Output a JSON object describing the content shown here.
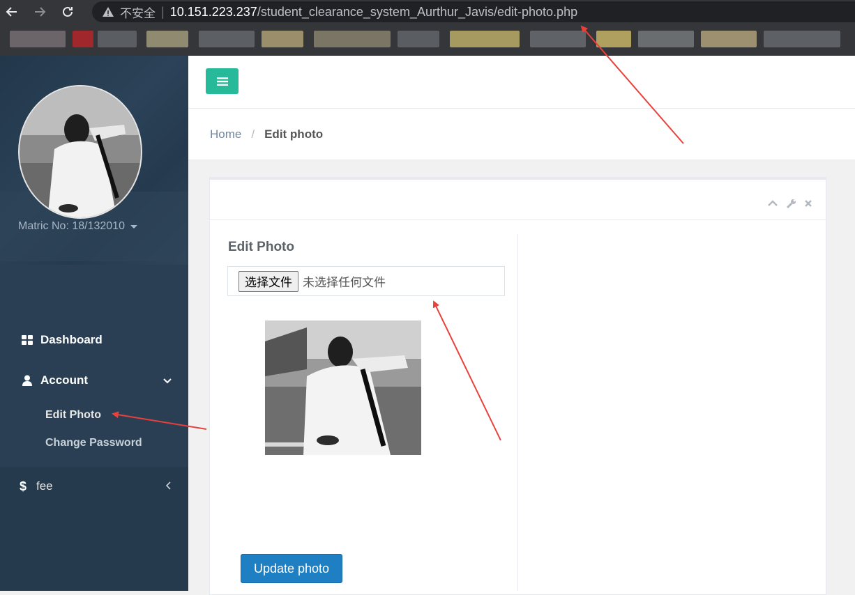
{
  "browser": {
    "insecure_label": "不安全",
    "url_host": "10.151.223.237",
    "url_path": "/student_clearance_system_Aurthur_Javis/edit-photo.php"
  },
  "sidebar": {
    "matric": "Matric No: 18/132010",
    "items": [
      {
        "label": "Dashboard",
        "icon": "dashboard-icon"
      },
      {
        "label": "Account",
        "icon": "user-icon"
      },
      {
        "label": "fee",
        "icon": "dollar-icon"
      }
    ],
    "account_submenu": [
      {
        "label": "Edit Photo"
      },
      {
        "label": "Change Password"
      }
    ]
  },
  "breadcrumb": {
    "home": "Home",
    "separator": "/",
    "active": "Edit photo"
  },
  "form": {
    "title": "Edit Photo",
    "file_button": "选择文件",
    "file_status": "未选择任何文件",
    "submit_label": "Update photo"
  },
  "colors": {
    "sidebar": "#2a3f54",
    "toggle": "#26b99a",
    "primary_button": "#1e7fc2",
    "annotation_arrow": "#e8403a"
  }
}
